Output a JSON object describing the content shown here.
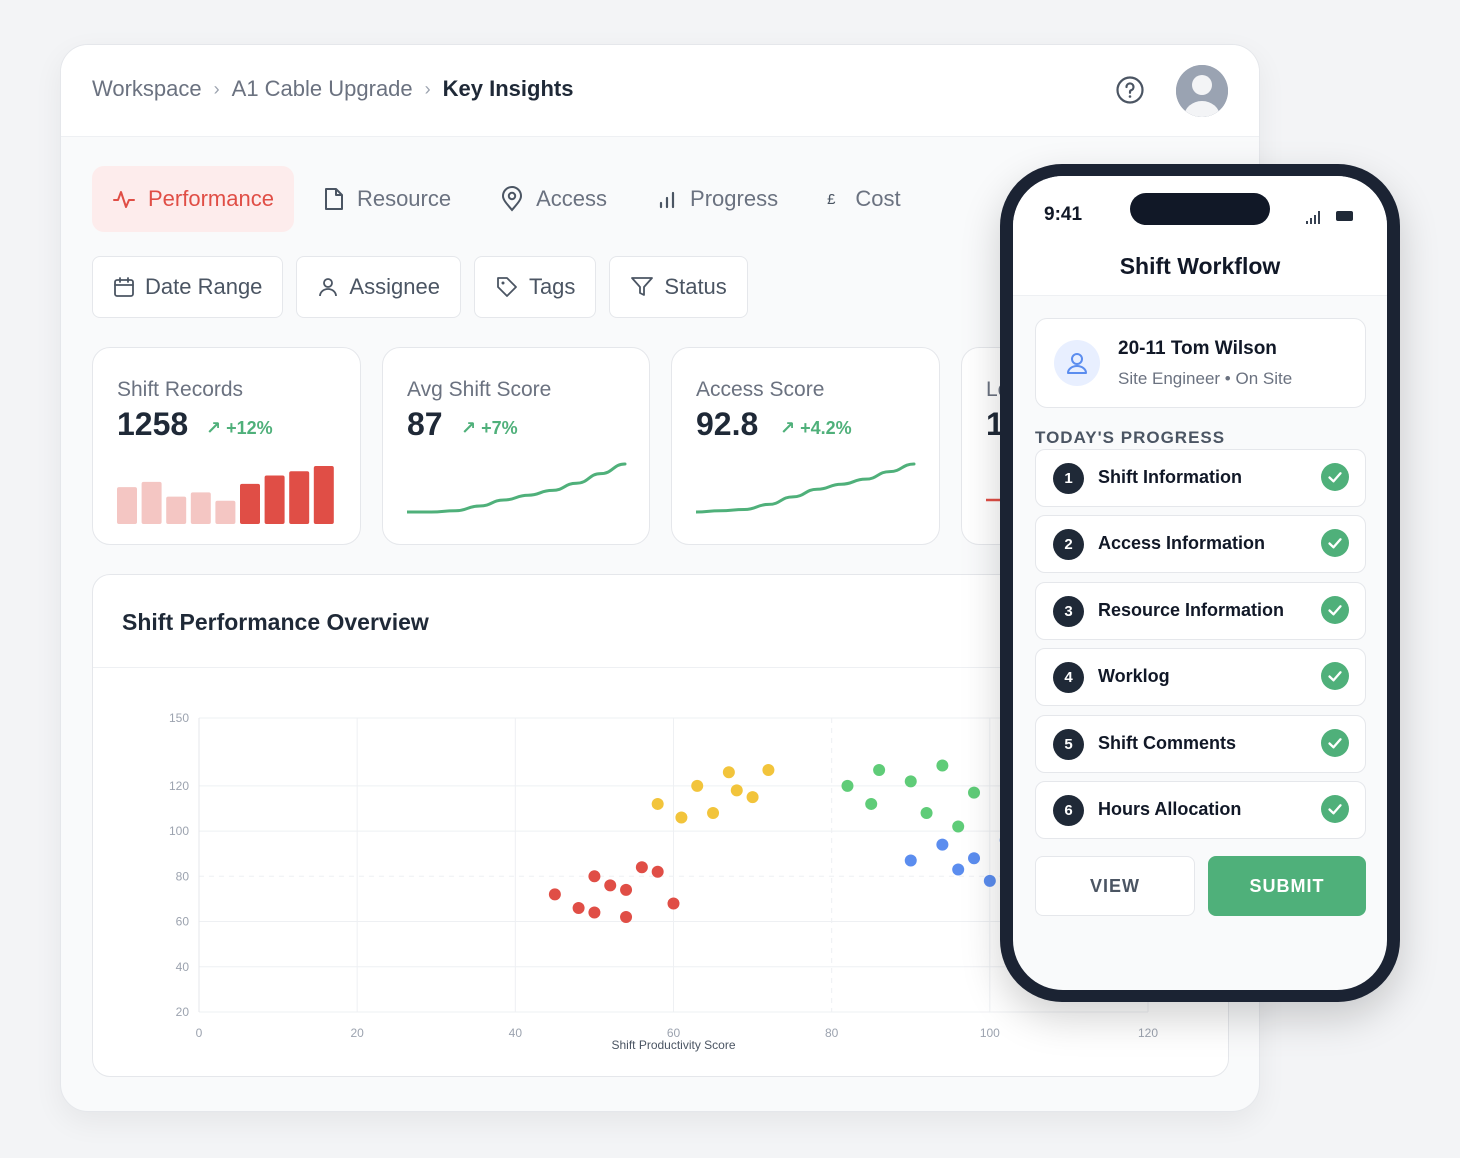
{
  "breadcrumb": {
    "items": [
      "Workspace",
      "A1 Cable Upgrade"
    ],
    "separator": "›",
    "current": "Key Insights"
  },
  "tabs": [
    {
      "label": "Performance",
      "icon": "activity-icon",
      "active": true
    },
    {
      "label": "Resource",
      "icon": "file-icon"
    },
    {
      "label": "Access",
      "icon": "map-pin-icon"
    },
    {
      "label": "Progress",
      "icon": "bar-chart-icon"
    },
    {
      "label": "Cost",
      "icon": "pound-icon",
      "symbol": "£"
    }
  ],
  "filters": [
    {
      "label": "Date Range",
      "icon": "calendar-icon"
    },
    {
      "label": "Assignee",
      "icon": "user-icon"
    },
    {
      "label": "Tags",
      "icon": "tag-icon"
    },
    {
      "label": "Status",
      "icon": "filter-icon"
    }
  ],
  "metrics": [
    {
      "label": "Shift Records",
      "value": "1258",
      "delta": "+12%"
    },
    {
      "label": "Avg Shift Score",
      "value": "87",
      "delta": "+7%"
    },
    {
      "label": "Access Score",
      "value": "92.8",
      "delta": "+4.2%"
    },
    {
      "label": "Lo",
      "value": "1"
    }
  ],
  "colors": {
    "accent_red": "#e04e46",
    "light_red": "#f4c6c3",
    "green": "#4fb07a",
    "yellow": "#f2c43b",
    "scatter_green": "#5fcc78",
    "blue": "#5b8def",
    "dark": "#1f2937"
  },
  "overview": {
    "title": "Shift Performance Overview"
  },
  "chart_data": [
    {
      "type": "bar",
      "values": [
        35,
        40,
        26,
        30,
        22,
        38,
        46,
        50,
        55
      ],
      "highlight_from_index": 5
    },
    {
      "type": "line",
      "values": [
        0,
        0,
        1,
        5,
        10,
        14,
        18,
        24,
        32,
        40
      ]
    },
    {
      "type": "line",
      "values": [
        0,
        1,
        2,
        6,
        12,
        18,
        22,
        26,
        32,
        38
      ]
    },
    {
      "type": "scatter",
      "xlabel": "Shift Productivity Score",
      "x_ticks": [
        0,
        20,
        40,
        60,
        80,
        100,
        120
      ],
      "y_ticks": [
        20,
        40,
        60,
        80,
        100,
        120,
        150
      ],
      "xlim": [
        0,
        120
      ],
      "ylim": [
        20,
        150
      ],
      "series": [
        {
          "color": "#e04e46",
          "points": [
            [
              45,
              72
            ],
            [
              48,
              66
            ],
            [
              50,
              80
            ],
            [
              50,
              64
            ],
            [
              52,
              76
            ],
            [
              54,
              74
            ],
            [
              54,
              62
            ],
            [
              56,
              84
            ],
            [
              58,
              82
            ],
            [
              60,
              68
            ]
          ]
        },
        {
          "color": "#f2c43b",
          "points": [
            [
              58,
              112
            ],
            [
              61,
              106
            ],
            [
              63,
              120
            ],
            [
              65,
              108
            ],
            [
              67,
              126
            ],
            [
              68,
              118
            ],
            [
              70,
              115
            ],
            [
              72,
              127
            ]
          ]
        },
        {
          "color": "#5fcc78",
          "points": [
            [
              82,
              120
            ],
            [
              85,
              112
            ],
            [
              86,
              127
            ],
            [
              90,
              122
            ],
            [
              92,
              108
            ],
            [
              94,
              129
            ],
            [
              96,
              102
            ],
            [
              98,
              117
            ]
          ]
        },
        {
          "color": "#5b8def",
          "points": [
            [
              90,
              87
            ],
            [
              94,
              94
            ],
            [
              96,
              83
            ],
            [
              98,
              88
            ],
            [
              100,
              78
            ],
            [
              102,
              96
            ]
          ]
        }
      ]
    }
  ],
  "phone": {
    "time": "9:41",
    "title": "Shift Workflow",
    "user": {
      "name": "20-11 Tom Wilson",
      "role": "Site Engineer • On Site"
    },
    "progress_label": "TODAY'S PROGRESS",
    "steps": [
      {
        "num": "1",
        "label": "Shift Information",
        "done": true
      },
      {
        "num": "2",
        "label": "Access Information",
        "done": true
      },
      {
        "num": "3",
        "label": "Resource Information",
        "done": true
      },
      {
        "num": "4",
        "label": "Worklog",
        "done": true
      },
      {
        "num": "5",
        "label": "Shift Comments",
        "done": true
      },
      {
        "num": "6",
        "label": "Hours Allocation",
        "done": true
      }
    ],
    "view_label": "VIEW",
    "submit_label": "SUBMIT"
  }
}
